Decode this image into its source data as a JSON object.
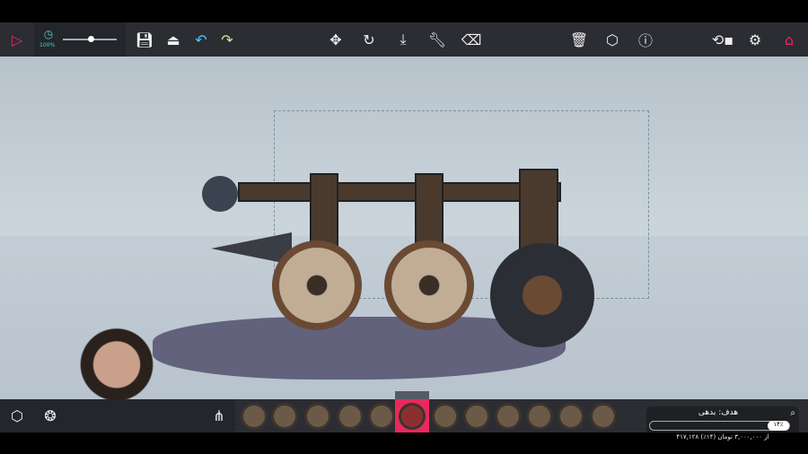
{
  "toolbar": {
    "zoom_percent": "100%",
    "time_slider_value": 0.5,
    "icons": [
      "play-icon",
      "clock-icon",
      "save-icon",
      "load-icon",
      "undo-icon",
      "redo-icon",
      "move-icon",
      "rotate-icon",
      "scale-icon",
      "wrench-icon",
      "eraser-icon",
      "delete-icon",
      "center-icon",
      "info-icon",
      "camera-icon",
      "gear-icon",
      "home-icon"
    ]
  },
  "blocks": {
    "selected_index": 6,
    "count": 12
  },
  "goal": {
    "title": "هدف: بدهی",
    "progress_label": "۱۴٪",
    "progress": 0.14,
    "subtitle": "۴۱۷,۱۲۸ از ۳,۰۰۰,۰۰۰ تومان (۱۴٪)"
  },
  "colors": {
    "accent": "#e8295b",
    "toolbar": "#2b2d33"
  }
}
